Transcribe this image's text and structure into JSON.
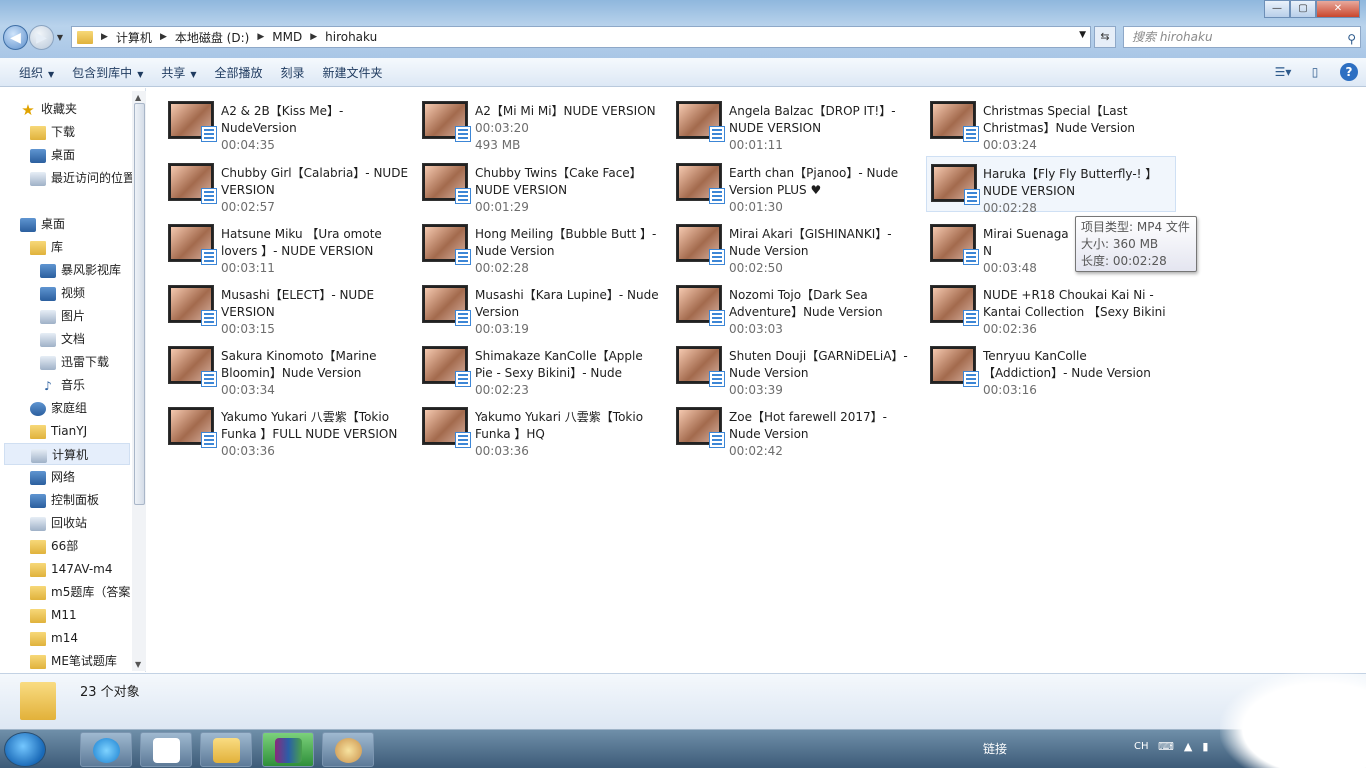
{
  "window": {
    "controls": [
      "—",
      "▢",
      "✕"
    ]
  },
  "address": {
    "crumbs": [
      "计算机",
      "本地磁盘 (D:)",
      "MMD",
      "hirohaku"
    ]
  },
  "search": {
    "placeholder": "搜索 hirohaku"
  },
  "toolbar": {
    "organize": "组织",
    "include_library": "包含到库中",
    "share": "共享",
    "play_all": "全部播放",
    "burn": "刻录",
    "new_folder": "新建文件夹",
    "help": "?"
  },
  "sidebar": {
    "favorites": "收藏夹",
    "downloads": "下载",
    "desktop_fav": "桌面",
    "recent": "最近访问的位置",
    "desktop": "桌面",
    "library": "库",
    "storm": "暴风影视库",
    "video": "视频",
    "pictures": "图片",
    "documents": "文档",
    "thunder": "迅雷下载",
    "music": "音乐",
    "homegroup": "家庭组",
    "user": "TianYJ",
    "computer": "计算机",
    "network": "网络",
    "control_panel": "控制面板",
    "recycle": "回收站",
    "f1": "66部",
    "f2": "147AV-m4",
    "f3": "m5题库（答案",
    "f4": "M11",
    "f5": "m14",
    "f6": "ME笔试题库"
  },
  "files": [
    {
      "name": "A2 & 2B【Kiss Me】- NudeVersion",
      "meta": "00:04:35"
    },
    {
      "name": "A2【Mi Mi Mi】NUDE VERSION",
      "meta": "00:03:20",
      "meta2": "493 MB"
    },
    {
      "name": "Angela Balzac【DROP IT!】- NUDE VERSION",
      "meta": "00:01:11"
    },
    {
      "name": "Christmas Special【Last Christmas】Nude Version",
      "meta": "00:03:24"
    },
    {
      "name": "Chubby Girl【Calabria】- NUDE VERSION",
      "meta": "00:02:57"
    },
    {
      "name": "Chubby Twins【Cake Face】NUDE VERSION",
      "meta": "00:01:29"
    },
    {
      "name": "Earth chan【Pjanoo】- Nude Version PLUS ♥",
      "meta": "00:01:30"
    },
    {
      "name": "Haruka【Fly Fly Butterfly-! 】NUDE VERSION",
      "meta": "00:02:28"
    },
    {
      "name": "Hatsune Miku 【Ura omote lovers 】- NUDE VERSION",
      "meta": "00:03:11"
    },
    {
      "name": "Hong Meiling【Bubble Butt 】- Nude Version",
      "meta": "00:02:28"
    },
    {
      "name": "Mirai Akari【GISHINANKI】- Nude Version",
      "meta": "00:02:50"
    },
    {
      "name": "Mirai Suenaga 【 NUMBER 9】- N",
      "meta": "00:03:48"
    },
    {
      "name": "Musashi【ELECT】- NUDE VERSION",
      "meta": "00:03:15"
    },
    {
      "name": "Musashi【Kara Lupine】- Nude Version",
      "meta": "00:03:19"
    },
    {
      "name": "Nozomi Tojo【Dark Sea Adventure】Nude Version",
      "meta": "00:03:03"
    },
    {
      "name": "NUDE +R18 Choukai Kai Ni - Kantai Collection 【Sexy Bikini ...",
      "meta": "00:02:36"
    },
    {
      "name": "Sakura Kinomoto【Marine Bloomin】Nude Version",
      "meta": "00:03:34"
    },
    {
      "name": "Shimakaze KanColle【Apple Pie - Sexy Bikini】- Nude Version",
      "meta": "00:02:23"
    },
    {
      "name": "Shuten Douji【GARNiDELiA】- Nude Version",
      "meta": "00:03:39"
    },
    {
      "name": "Tenryuu KanColle【Addiction】- Nude Version",
      "meta": "00:03:16"
    },
    {
      "name": "Yakumo Yukari 八雲紫【Tokio Funka 】FULL NUDE VERSION",
      "meta": "00:03:36"
    },
    {
      "name": "Yakumo Yukari 八雲紫【Tokio Funka 】HQ",
      "meta": "00:03:36"
    },
    {
      "name": "Zoe【Hot farewell 2017】- Nude Version",
      "meta": "00:02:42"
    }
  ],
  "tooltip": {
    "type": "项目类型: MP4 文件",
    "size": "大小: 360 MB",
    "length": "长度: 00:02:28"
  },
  "status": {
    "count": "23 个对象"
  },
  "taskbar": {
    "links": "链接",
    "lang": "CH"
  }
}
